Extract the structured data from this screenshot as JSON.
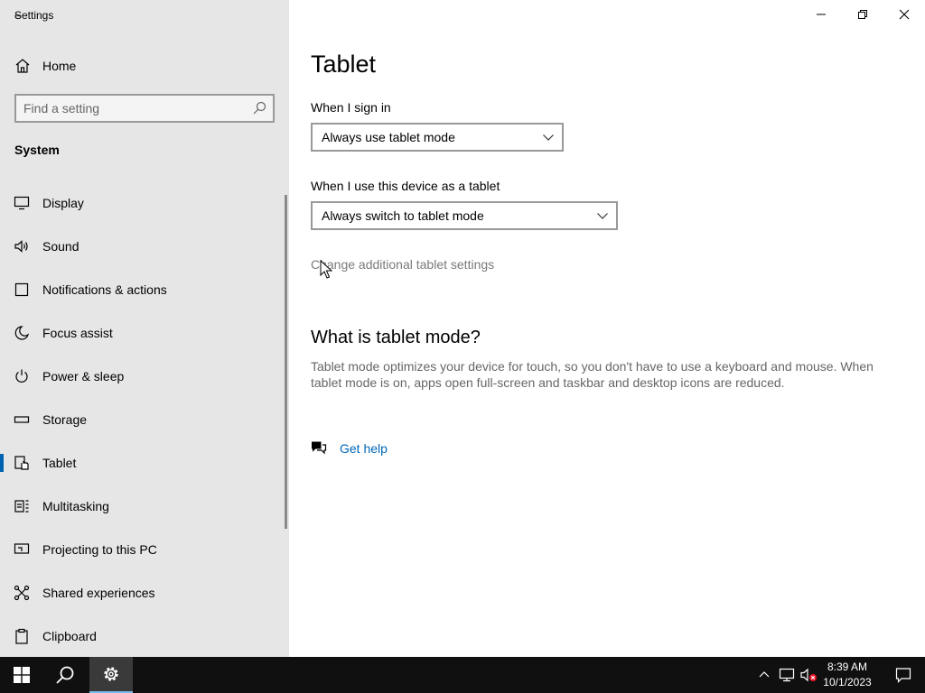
{
  "window": {
    "title": "Settings",
    "back_glyph": "←"
  },
  "sidebar": {
    "home_label": "Home",
    "search_placeholder": "Find a setting",
    "section_label": "System",
    "items": [
      {
        "label": "Display",
        "icon": "display-icon"
      },
      {
        "label": "Sound",
        "icon": "speaker-icon"
      },
      {
        "label": "Notifications & actions",
        "icon": "notifications-icon"
      },
      {
        "label": "Focus assist",
        "icon": "moon-icon"
      },
      {
        "label": "Power & sleep",
        "icon": "power-icon"
      },
      {
        "label": "Storage",
        "icon": "storage-icon"
      },
      {
        "label": "Tablet",
        "icon": "tablet-icon",
        "active": true
      },
      {
        "label": "Multitasking",
        "icon": "multitasking-icon"
      },
      {
        "label": "Projecting to this PC",
        "icon": "projector-icon"
      },
      {
        "label": "Shared experiences",
        "icon": "shared-icon"
      },
      {
        "label": "Clipboard",
        "icon": "clipboard-icon"
      }
    ]
  },
  "main": {
    "title": "Tablet",
    "sign_in_label": "When I sign in",
    "sign_in_value": "Always use tablet mode",
    "device_label": "When I use this device as a tablet",
    "device_value": "Always switch to tablet mode",
    "additional_link": "Change additional tablet settings",
    "what_heading": "What is tablet mode?",
    "what_desc": "Tablet mode optimizes your device for touch, so you don't have to use a keyboard and mouse. When tablet mode is on, apps open full-screen and taskbar and desktop icons are reduced.",
    "help_label": "Get help"
  },
  "taskbar": {
    "time": "8:39 AM",
    "date": "10/1/2023"
  },
  "colors": {
    "accent": "#0063b1",
    "link": "#0067b8",
    "sidebar_bg": "#e6e6e6",
    "taskbar_bg": "#101010"
  }
}
